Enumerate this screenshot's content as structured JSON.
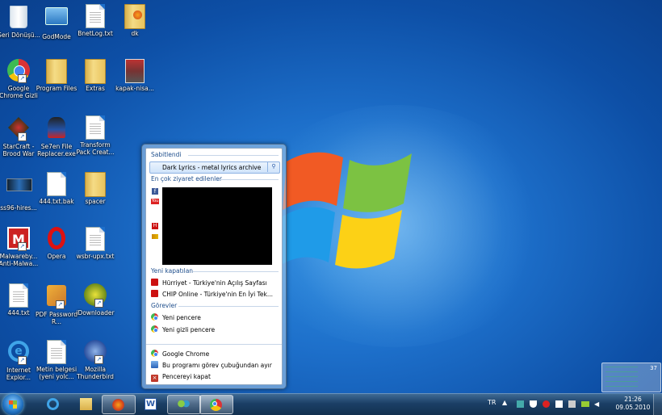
{
  "desktop": {
    "icons": [
      {
        "label": "Geri Dönüşü...",
        "icon": "recycle-bin-icon"
      },
      {
        "label": "GodMode",
        "icon": "control-panel-icon"
      },
      {
        "label": "BnetLog.txt",
        "icon": "text-file-icon"
      },
      {
        "label": "dk",
        "icon": "firefox-folder-icon"
      },
      {
        "label": "Google Chrome Gizli",
        "icon": "chrome-icon"
      },
      {
        "label": "Program Files",
        "icon": "folder-icon"
      },
      {
        "label": "Extras",
        "icon": "folder-icon"
      },
      {
        "label": "kapak-nisa...",
        "icon": "image-file-icon"
      },
      {
        "label": "StarCraft - Brood War",
        "icon": "starcraft-icon"
      },
      {
        "label": "Se7en File Replacer.exe",
        "icon": "ninja-app-icon"
      },
      {
        "label": "Transform Pack Creat...",
        "icon": "text-file-icon"
      },
      {
        "label": "ss96-hires...",
        "icon": "image-file-icon"
      },
      {
        "label": "444.txt.bak",
        "icon": "text-file-icon"
      },
      {
        "label": "spacer",
        "icon": "folder-icon"
      },
      {
        "label": "Malwareby... Anti-Malwa...",
        "icon": "malwarebytes-icon"
      },
      {
        "label": "Opera",
        "icon": "opera-icon"
      },
      {
        "label": "wsbr-upx.txt",
        "icon": "text-file-icon"
      },
      {
        "label": "444.txt",
        "icon": "text-file-icon"
      },
      {
        "label": "PDF Password R...",
        "icon": "pdf-tool-icon"
      },
      {
        "label": "iDownloader",
        "icon": "downloader-icon"
      },
      {
        "label": "Internet Explor...",
        "icon": "internet-explorer-icon"
      },
      {
        "label": "Metin belgesi (yeni yolc...",
        "icon": "text-file-icon"
      },
      {
        "label": "Mozilla Thunderbird",
        "icon": "thunderbird-icon"
      }
    ]
  },
  "jumplist": {
    "pinned_header": "Sabitlendi",
    "pinned_item": "Dark Lyrics - metal lyrics archive",
    "most_visited_header": "En çok ziyaret edilenler",
    "recently_closed_header": "Yeni kapatılan",
    "recently_closed": [
      {
        "label": "Hürriyet - Türkiye'nin Açılış Sayfası",
        "icon": "hurriyet-icon"
      },
      {
        "label": "CHIP Online - Türkiye'nin En İyi Tek...",
        "icon": "chip-icon"
      }
    ],
    "tasks_header": "Görevler",
    "tasks": [
      {
        "label": "Yeni pencere",
        "icon": "chrome-icon"
      },
      {
        "label": "Yeni gizli pencere",
        "icon": "chrome-icon"
      }
    ],
    "app_items": [
      {
        "label": "Google Chrome",
        "icon": "chrome-icon"
      },
      {
        "label": "Bu programı görev çubuğundan ayır",
        "icon": "unpin-icon"
      },
      {
        "label": "Pencereyi kapat",
        "icon": "close-icon"
      }
    ]
  },
  "taskbar": {
    "language": "TR",
    "time": "21:26",
    "date": "09.05.2010",
    "gadget_value": "37",
    "buttons": [
      "internet-explorer",
      "explorer",
      "firefox",
      "word",
      "messenger",
      "chrome"
    ]
  },
  "colors": {
    "desktop_blue": "#1d6fca",
    "taskbar": "#1b3f66",
    "section_title": "#1e4e8c"
  }
}
